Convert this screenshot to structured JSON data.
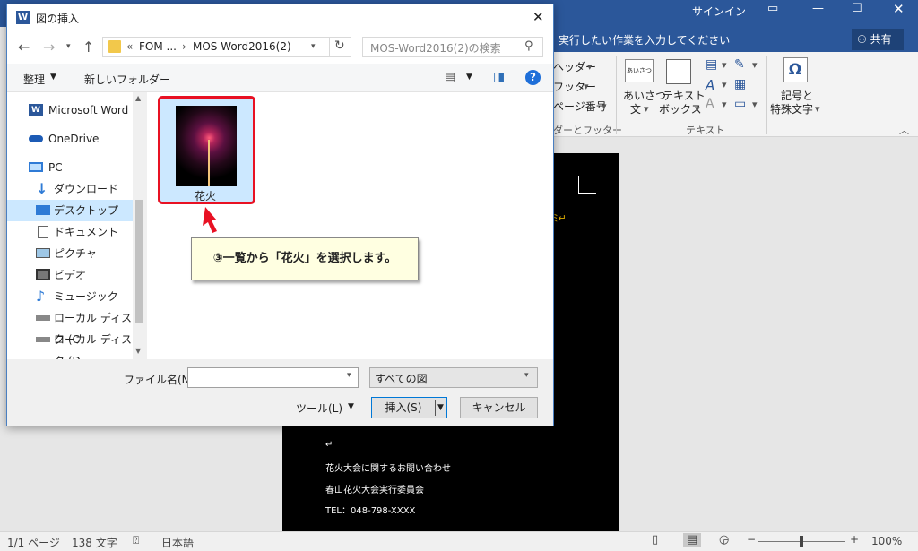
{
  "word": {
    "signin": "サインイン",
    "tellme": "実行したい作業を入力してください",
    "share": "共有"
  },
  "ribbon": {
    "header": "ヘッダー",
    "footer": "フッター",
    "page_number": "ページ番号",
    "group_hf": "ダーとフッター",
    "greeting_l1": "あいさつ",
    "greeting_l2": "文",
    "textbox_l1": "テキスト",
    "textbox_l2": "ボックス",
    "group_text": "テキスト",
    "symbols_l1": "記号と",
    "symbols_l2": "特殊文字",
    "greet_icon_text": "あいさつ"
  },
  "document": {
    "lines": [
      "花火大会に関するお問い合わせ",
      "春山花火大会実行委員会",
      "TEL：048-798-XXXX"
    ]
  },
  "status": {
    "page": "1/1 ページ",
    "words": "138 文字",
    "lang": "日本語",
    "zoom": "100%"
  },
  "dialog": {
    "title": "図の挿入",
    "breadcrumb": [
      "FOM ...",
      "MOS-Word2016(2)"
    ],
    "breadcrumb_prefix": "«",
    "search_placeholder": "MOS-Word2016(2)の検索",
    "organize": "整理",
    "new_folder": "新しいフォルダー",
    "nav": [
      {
        "label": "Microsoft Word",
        "icon": "word-icon"
      },
      {
        "label": "OneDrive",
        "icon": "onedrive-icon"
      },
      {
        "label": "PC",
        "icon": "pc-icon"
      },
      {
        "label": "ダウンロード",
        "icon": "download-icon"
      },
      {
        "label": "デスクトップ",
        "icon": "desktop-icon"
      },
      {
        "label": "ドキュメント",
        "icon": "documents-icon"
      },
      {
        "label": "ピクチャ",
        "icon": "pictures-icon"
      },
      {
        "label": "ビデオ",
        "icon": "video-icon"
      },
      {
        "label": "ミュージック",
        "icon": "music-icon"
      },
      {
        "label": "ローカル ディスク (C",
        "icon": "disk-icon"
      },
      {
        "label": "ローカル ディスク (D",
        "icon": "disk-icon"
      }
    ],
    "file": {
      "name": "花火"
    },
    "callout": "③一覧から「花火」を選択します。",
    "filename_label": "ファイル名(N):",
    "filename_value": "",
    "filetype": "すべての図",
    "tools": "ツール(L)",
    "insert": "挿入(S)",
    "cancel": "キャンセル"
  },
  "colors": {
    "word_blue": "#2b579a",
    "highlight": "#e81123",
    "callout_bg": "#ffffe1"
  }
}
